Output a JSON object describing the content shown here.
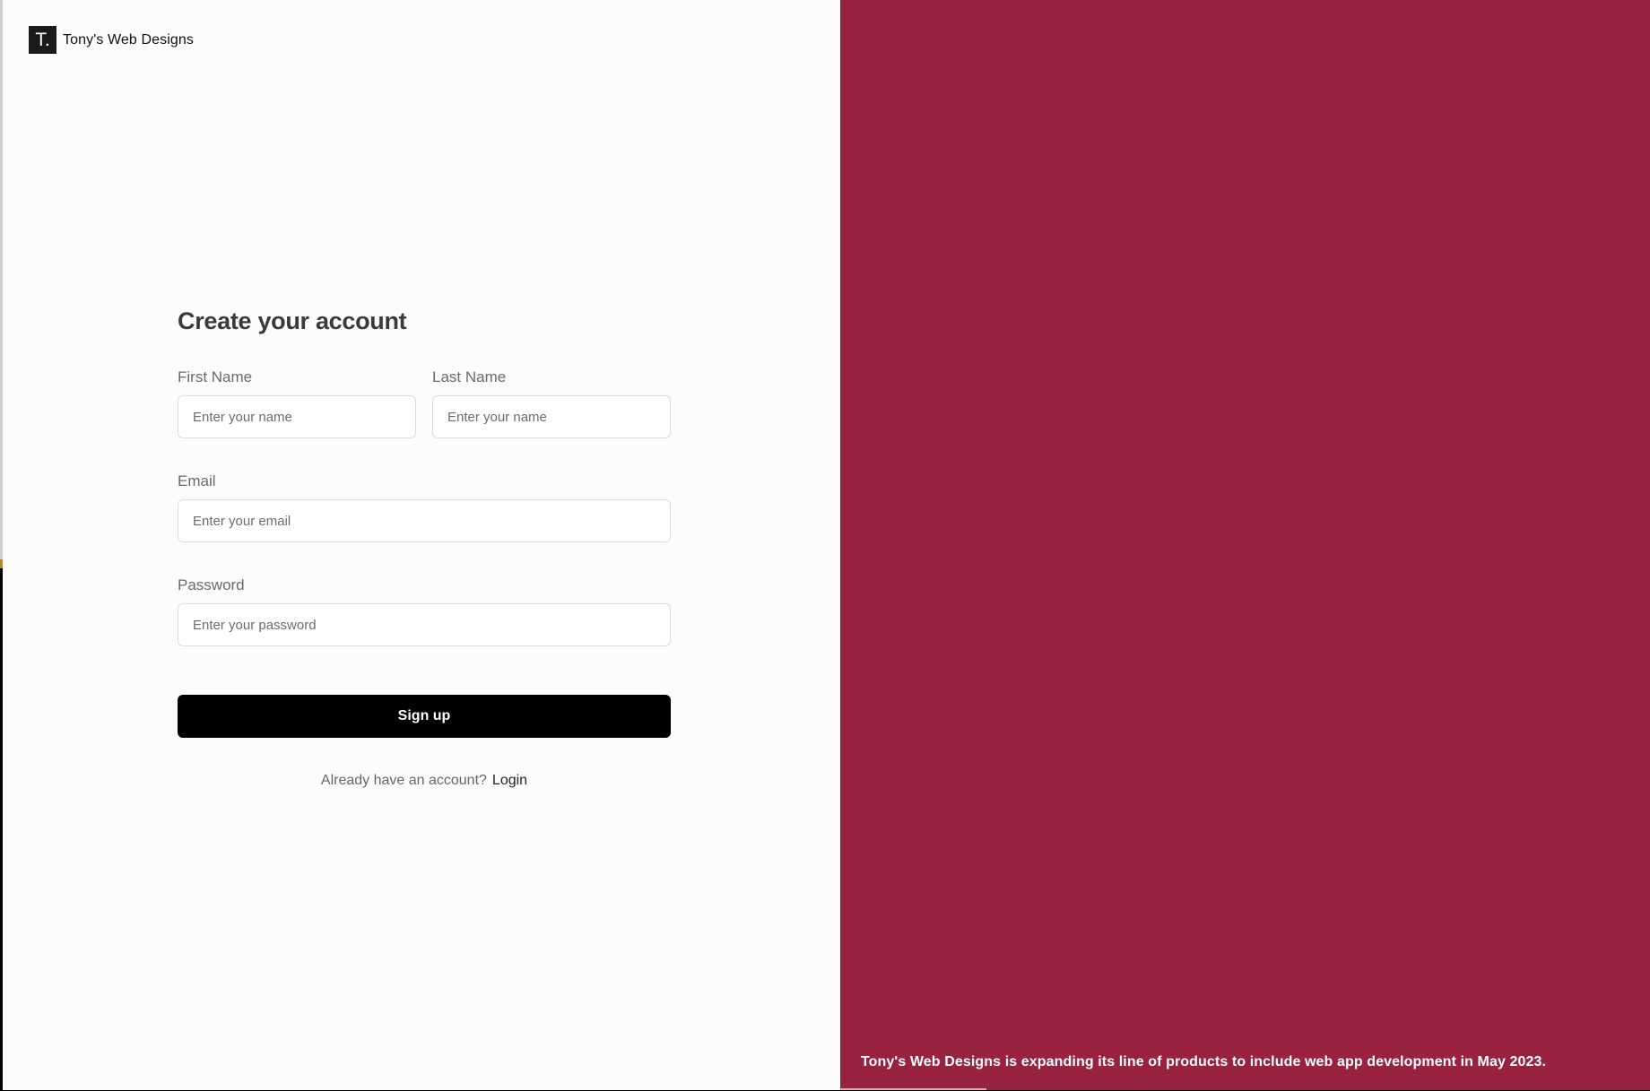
{
  "brand": {
    "logo_text": "T.",
    "name": "Tony's Web Designs"
  },
  "form": {
    "title": "Create your account",
    "first_name": {
      "label": "First Name",
      "placeholder": "Enter your name",
      "value": ""
    },
    "last_name": {
      "label": "Last Name",
      "placeholder": "Enter your name",
      "value": ""
    },
    "email": {
      "label": "Email",
      "placeholder": "Enter your email",
      "value": ""
    },
    "password": {
      "label": "Password",
      "placeholder": "Enter your password",
      "value": ""
    },
    "submit_label": "Sign up",
    "login_prompt": "Already have an account?",
    "login_link": "Login"
  },
  "side_panel": {
    "background_color": "#98223f",
    "announcement": "Tony's Web Designs is expanding its line of products to include web app development in May 2023.",
    "slide_progress": 0.18
  },
  "colors": {
    "left_background": "#fcfcfc",
    "button_background": "#000000",
    "progress_fill": "#e7a6b9"
  }
}
